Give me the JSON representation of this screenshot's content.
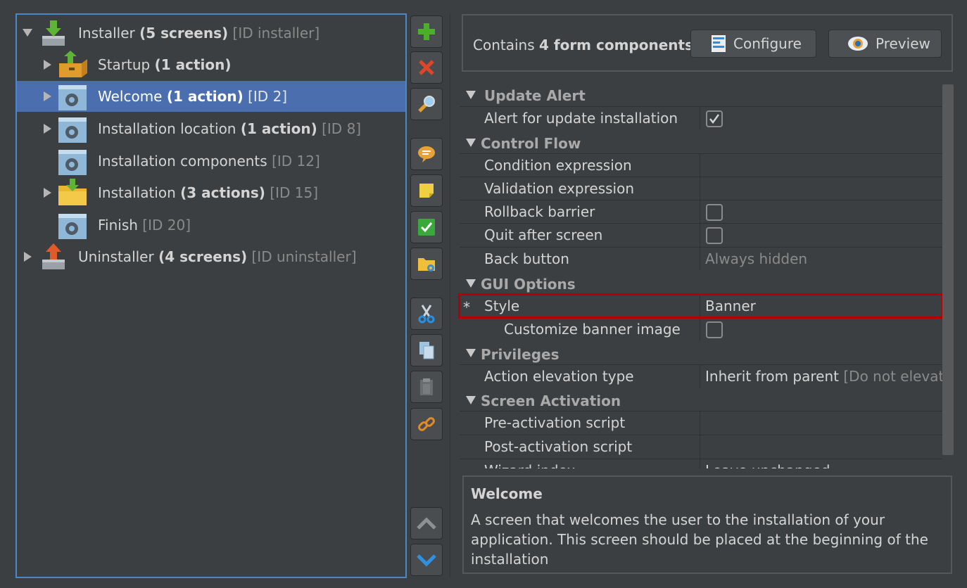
{
  "tree": {
    "installer": {
      "name": "Installer",
      "count": "(5 screens)",
      "id": "[ID installer]"
    },
    "startup": {
      "name": "Startup",
      "count": "(1 action)",
      "id": ""
    },
    "welcome": {
      "name": "Welcome",
      "count": "(1 action)",
      "id": "[ID 2]"
    },
    "location": {
      "name": "Installation location",
      "count": "(1 action)",
      "id": "[ID 8]"
    },
    "components": {
      "name": "Installation components",
      "count": "",
      "id": "[ID 12]"
    },
    "installation": {
      "name": "Installation",
      "count": "(3 actions)",
      "id": "[ID 15]"
    },
    "finish": {
      "name": "Finish",
      "count": "",
      "id": "[ID 20]"
    },
    "uninstaller": {
      "name": "Uninstaller",
      "count": "(4 screens)",
      "id": "[ID uninstaller]"
    }
  },
  "header": {
    "contains_prefix": "Contains",
    "contains_bold": "4 form components",
    "configure_label": "Configure",
    "preview_label": "Preview"
  },
  "props": {
    "update_alert": {
      "title": "Update Alert",
      "alert_label": "Alert for update installation",
      "alert_checked": true
    },
    "control_flow": {
      "title": "Control Flow",
      "condition_label": "Condition expression",
      "condition_value": "",
      "validation_label": "Validation expression",
      "validation_value": "",
      "rollback_label": "Rollback barrier",
      "rollback_checked": false,
      "quit_label": "Quit after screen",
      "quit_checked": false,
      "back_label": "Back button",
      "back_value": "Always hidden"
    },
    "gui_options": {
      "title": "GUI Options",
      "style_marker": "*",
      "style_label": "Style",
      "style_value": "Banner",
      "banner_label": "Customize banner image",
      "banner_checked": false
    },
    "privileges": {
      "title": "Privileges",
      "elevation_label": "Action elevation type",
      "elevation_value": "Inherit from parent",
      "elevation_hint": "[Do not elevate]"
    },
    "activation": {
      "title": "Screen Activation",
      "pre_label": "Pre-activation script",
      "pre_value": "",
      "post_label": "Post-activation script",
      "post_value": "",
      "wizard_label": "Wizard index",
      "wizard_value": "Leave unchanged"
    }
  },
  "description": {
    "title": "Welcome",
    "text": "A screen that welcomes the user to the installation of your application. This screen should be placed at the beginning of the installation"
  },
  "colors": {
    "selection": "#4b6eaf",
    "tree_border": "#4a88c7",
    "highlight_border": "#b30000",
    "background": "#3c3f41"
  },
  "icons": {
    "installer": "green-down-arrow-box-icon",
    "screen": "gear-window-icon",
    "startup": "box-up-arrow-icon",
    "installation": "folder-download-icon",
    "uninstaller": "red-up-arrow-box-icon",
    "toolbar": [
      "add-icon",
      "delete-icon",
      "search-icon",
      "message-icon",
      "note-icon",
      "check-icon",
      "folder-settings-icon",
      "cut-icon",
      "copy-icon",
      "paste-icon",
      "link-icon",
      "move-up-icon",
      "move-down-icon"
    ]
  }
}
